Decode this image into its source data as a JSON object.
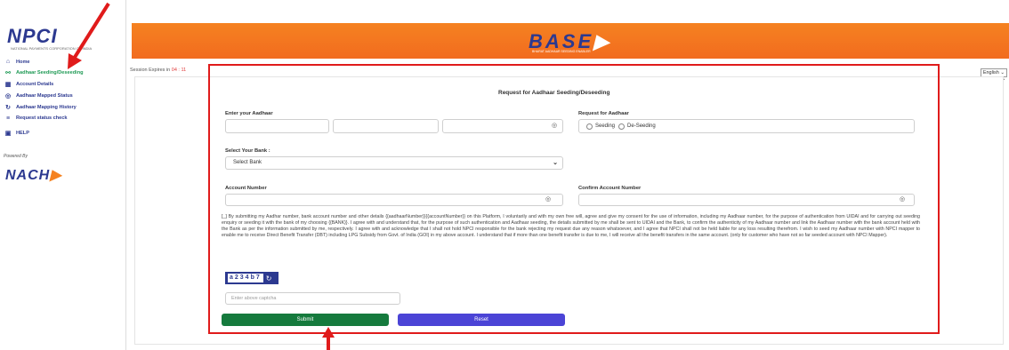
{
  "sidebar": {
    "logo_text": "NPCI",
    "logo_tag": "NATIONAL PAYMENTS CORPORATION OF INDIA",
    "items": [
      {
        "label": "Home",
        "icon": "home-icon",
        "active": false
      },
      {
        "label": "Aadhaar Seeding/Deseeding",
        "icon": "seeding-icon",
        "active": true
      },
      {
        "label": "Account Details",
        "icon": "bank-icon",
        "active": false
      },
      {
        "label": "Aadhaar Mapped Status",
        "icon": "status-icon",
        "active": false
      },
      {
        "label": "Aadhaar Mapping History",
        "icon": "history-icon",
        "active": false
      },
      {
        "label": "Request status check",
        "icon": "list-icon",
        "active": false
      },
      {
        "label": "HELP",
        "icon": "help-icon",
        "active": false
      }
    ],
    "powered_by": "Powered By",
    "nach_text": "NACH"
  },
  "header": {
    "app_name": "BASE",
    "app_tag": "BHARAT AADHAAR SEEDING ENABLER",
    "session_label": "Session Expires in",
    "session_time": "04 : 11",
    "language": "English"
  },
  "form": {
    "title": "Request for Aadhaar Seeding/Deseeding",
    "aadhaar_label": "Enter your Aadhaar",
    "request_label": "Request for Aadhaar",
    "seeding_option": "Seeding",
    "deseeding_option": "De-Seeding",
    "bank_label": "Select Your Bank :",
    "bank_selected": "Select Bank",
    "account_label": "Account Number",
    "confirm_account_label": "Confirm Account Number",
    "consent_text": "By submitting my Aadhar number, bank account number and other details {{aadhaarNumber}}{{accountNumber}} on this Platform, I voluntarily and with my own free will, agree and give my consent for the use of information, including my Aadhaar number, for the purpose of authentication from UIDAI and for carrying out seeding enquiry or seeding it with the bank of my choosing {{BANK}}. I agree with and understand that, for the purpose of such authentication and Aadhaar seeding, the details submitted by me shall be sent to UIDAI and the Bank, to confirm the authenticity of my Aadhaar number and link the Aadhaar number with the bank account held with the Bank as per the information submitted by me, respectively. I agree with and acknowledge that I shall not hold NPCI responsible for the bank rejecting my request due any reason whatsoever, and I agree that NPCI shall not be held liable for any loss resulting therefrom. I wish to seed my Aadhaar number with NPCI mapper to enable me to receive Direct Benefit Transfer (DBT) including LPG Subsidy from Govt. of India (GOI) in my above account. I understand that if more than one benefit transfer is due to me, I will receive all the benefit transfers in the same account. (only for customer who have not so far seeded account with NPCI Mapper).",
    "captcha_code": "a234b7",
    "captcha_placeholder": "Enter above captcha",
    "submit_label": "Submit",
    "reset_label": "Reset"
  },
  "colors": {
    "brand_blue": "#2c3990",
    "brand_orange": "#f58220",
    "active_green": "#1f9a55",
    "submit_green": "#157a3d",
    "reset_purple": "#4b44d6",
    "highlight_red": "#e01b1b",
    "session_red": "#e03c3c"
  }
}
